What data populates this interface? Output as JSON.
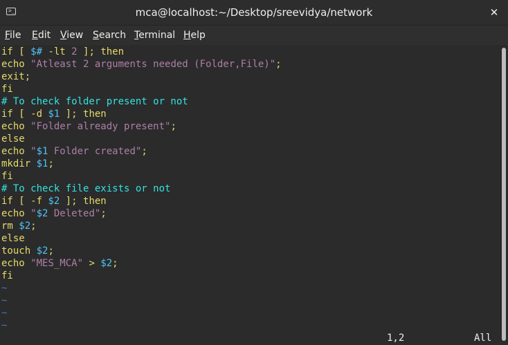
{
  "window": {
    "title": "mca@localhost:~/Desktop/sreevidya/network",
    "close_glyph": "✕",
    "icon": "terminal-icon"
  },
  "menu": [
    {
      "label_u": "F",
      "label_rest": "ile"
    },
    {
      "label_u": "E",
      "label_rest": "dit"
    },
    {
      "label_u": "V",
      "label_rest": "iew"
    },
    {
      "label_u": "S",
      "label_rest": "earch"
    },
    {
      "label_u": "T",
      "label_rest": "erminal"
    },
    {
      "label_u": "H",
      "label_rest": "elp"
    }
  ],
  "code": {
    "l1": {
      "a": "if [ ",
      "b": "$#",
      "c": " -lt ",
      "d": "2",
      "e": " ]; then"
    },
    "l2": {
      "a": "echo ",
      "b": "\"Atleast 2 arguments needed (Folder,File)\"",
      "c": ";"
    },
    "l3": "exit;",
    "l4": "fi",
    "l5": "# To check folder present or not",
    "l6": {
      "a": "if [ -d ",
      "b": "$1",
      "c": " ]; then"
    },
    "l7": {
      "a": "echo ",
      "b": "\"Folder already present\"",
      "c": ";"
    },
    "l8": "else",
    "l9": {
      "a": "echo ",
      "b": "\"",
      "c": "$1",
      "d": " Folder created\"",
      "e": ";"
    },
    "l10": {
      "a": "mkdir ",
      "b": "$1",
      "c": ";"
    },
    "l11": "fi",
    "l12": "# To check file exists or not",
    "l13": {
      "a": "if [ -f ",
      "b": "$2",
      "c": " ]; then"
    },
    "l14": {
      "a": "echo ",
      "b": "\"",
      "c": "$2",
      "d": " Deleted\"",
      "e": ";"
    },
    "l15": {
      "a": "rm ",
      "b": "$2",
      "c": ";"
    },
    "l16": "else",
    "l17": {
      "a": "touch ",
      "b": "$2",
      "c": ";"
    },
    "l18": {
      "a": "echo ",
      "b": "\"MES_MCA\"",
      "c": " > ",
      "d": "$2",
      "e": ";"
    },
    "l19": "fi"
  },
  "tilde": "~",
  "status": {
    "position": "1,2",
    "scroll": "All"
  }
}
